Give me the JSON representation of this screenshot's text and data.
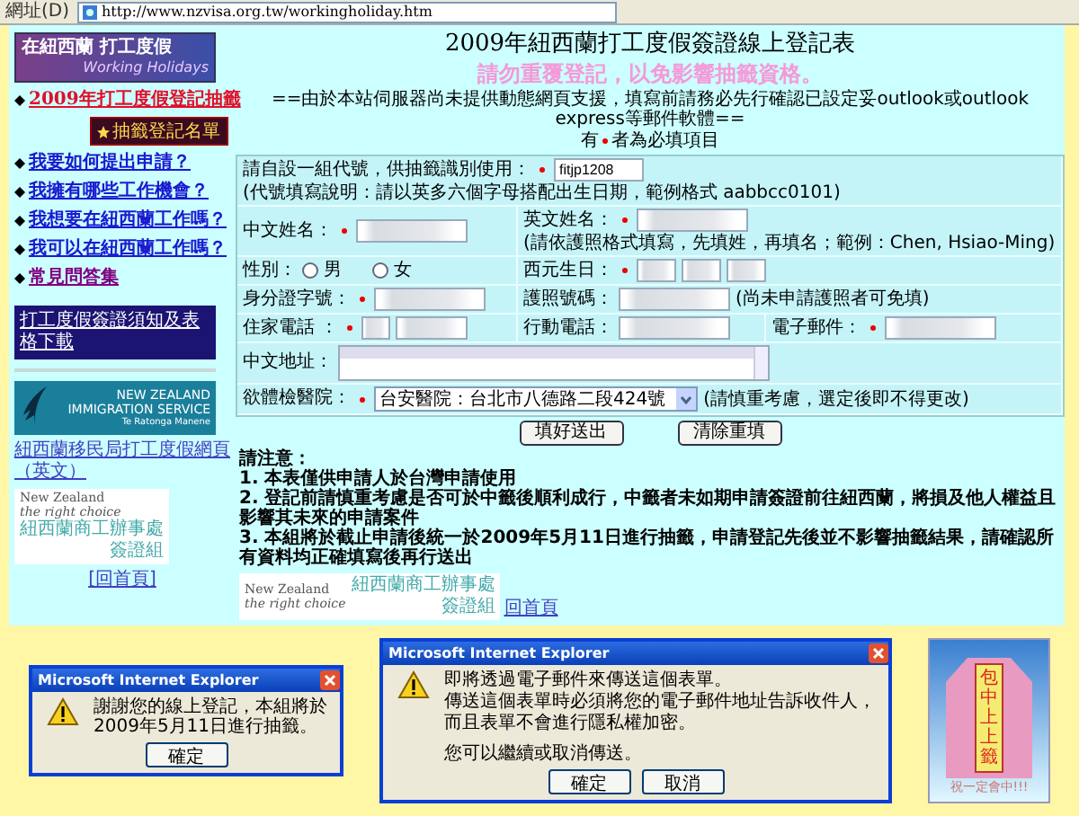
{
  "address_bar": {
    "label": "網址(D)",
    "url": "http://www.nzvisa.org.tw/workingholiday.htm"
  },
  "sidebar": {
    "logo": {
      "title": "在紐西蘭 打工度假",
      "subtitle": "Working Holidays"
    },
    "highlight_link": "2009年打工度假登記抽籤",
    "badge": "抽籤登記名單",
    "links": [
      {
        "label": "我要如何提出申請？",
        "visited": false
      },
      {
        "label": "我擁有哪些工作機會？",
        "visited": false
      },
      {
        "label": "我想要在紐西蘭工作嗎？",
        "visited": false
      },
      {
        "label": "我可以在紐西蘭工作嗎？",
        "visited": false
      },
      {
        "label": "常見問答集",
        "visited": true
      }
    ],
    "download_button": "打工度假簽證須知及表格下載",
    "immigration_logo": {
      "lines": [
        "NEW ZEALAND",
        "IMMIGRATION SERVICE",
        "Te Ratonga Manene"
      ]
    },
    "immigration_link": "紐西蘭移民局打工度假網頁（英文）",
    "office_logo": {
      "brand": "New Zealand",
      "slogan": "the right choice",
      "office": "紐西蘭商工辦事處",
      "unit": "簽證組"
    },
    "home_link": "[回首頁]"
  },
  "main": {
    "title": "2009年紐西蘭打工度假簽證線上登記表",
    "warning": "請勿重覆登記，以免影響抽籤資格。",
    "notice": "==由於本站伺服器尚未提供動態網頁支援，填寫前請務必先行確認已設定妥outlook或outlook express等郵件軟體==",
    "required_note": {
      "before": "有",
      "after": "者為必填項目"
    },
    "form_rows": [
      {
        "cells": [
          {
            "kind": "text",
            "label": "請自設一組代號，供抽籤識別使用：",
            "required": true,
            "value": "fitjp1208",
            "hint": "(代號填寫說明：請以英多六個字母搭配出生日期，範例格式 aabbcc0101)"
          }
        ]
      },
      {
        "cells": [
          {
            "kind": "text",
            "label": "中文姓名：",
            "required": true
          },
          {
            "kind": "text",
            "label": "英文姓名：",
            "required": true,
            "hint": "(請依護照格式填寫，先填姓，再填名；範例：Chen, Hsiao-Ming)"
          }
        ]
      },
      {
        "cells": [
          {
            "kind": "radio",
            "label": "性別：",
            "required": false,
            "options": [
              {
                "label": "男",
                "selected": false
              },
              {
                "label": "女",
                "selected": false
              }
            ]
          },
          {
            "kind": "date",
            "label": "西元生日：",
            "required": true
          }
        ]
      },
      {
        "cells": [
          {
            "kind": "text",
            "label": "身分證字號：",
            "required": true
          },
          {
            "kind": "text",
            "label": "護照號碼：",
            "required": false,
            "hint": "(尚未申請護照者可免填)"
          }
        ]
      },
      {
        "cells": [
          {
            "kind": "phone",
            "label": "住家電話 ：",
            "required": true
          },
          {
            "kind": "text",
            "label": "行動電話：",
            "required": false
          },
          {
            "kind": "text",
            "label": "電子郵件：",
            "required": true
          }
        ]
      },
      {
        "cells": [
          {
            "kind": "textarea",
            "label": "中文地址：",
            "required": false
          }
        ]
      },
      {
        "cells": [
          {
            "kind": "select",
            "label": "欲體檢醫院：",
            "required": true,
            "value": "台安醫院：台北市八德路二段424號",
            "hint": "(請慎重考慮，選定後即不得更改)"
          }
        ]
      }
    ],
    "buttons": [
      "填好送出",
      "清除重填"
    ],
    "notes_title": "請注意：",
    "notes": [
      "1. 本表僅供申請人於台灣申請使用",
      "2. 登記前請慎重考慮是否可於中籤後順利成行，中籤者未如期申請簽證前往紐西蘭，將損及他人權益且影響其未來的申請案件",
      "3. 本組將於截止申請後統一於2009年5月11日進行抽籤，申請登記先後並不影響抽籤結果，請確認所有資料均正確填寫後再行送出"
    ],
    "office_logo": {
      "brand": "New Zealand",
      "slogan": "the right choice",
      "office": "紐西蘭商工辦事處",
      "unit": "簽證組"
    },
    "home_link": "回首頁"
  },
  "dialogs": [
    {
      "title": "Microsoft Internet Explorer",
      "lines": [
        "謝謝您的線上登記，本組將於2009年5月11日進行抽籤。"
      ],
      "buttons": [
        "確定"
      ]
    },
    {
      "title": "Microsoft Internet Explorer",
      "lines": [
        "即將透過電子郵件來傳送這個表單。",
        "傳送這個表單時必須將您的電子郵件地址告訴收件人，",
        "而且表單不會進行隱私權加密。",
        "您可以繼續或取消傳送。"
      ],
      "buttons": [
        "確定",
        "取消"
      ]
    }
  ],
  "amulet": {
    "label": "包中上上籤",
    "caption": "祝一定會中!!!"
  }
}
